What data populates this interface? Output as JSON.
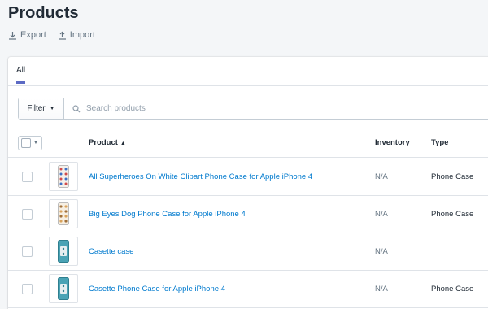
{
  "page": {
    "title": "Products"
  },
  "actions": {
    "export_label": "Export",
    "import_label": "Import"
  },
  "tabs": [
    {
      "label": "All"
    }
  ],
  "filter": {
    "button_label": "Filter",
    "search_placeholder": "Search products"
  },
  "table": {
    "headers": {
      "product": "Product",
      "inventory": "Inventory",
      "type": "Type"
    },
    "rows": [
      {
        "name": "All Superheroes On White Clipart Phone Case for Apple iPhone 4",
        "inventory": "N/A",
        "type": "Phone Case",
        "thumb_icon": "phone-case-pattern-icon"
      },
      {
        "name": "Big Eyes Dog Phone Case for Apple iPhone 4",
        "inventory": "N/A",
        "type": "Phone Case",
        "thumb_icon": "phone-case-pattern-icon"
      },
      {
        "name": "Casette case",
        "inventory": "N/A",
        "type": "",
        "thumb_icon": "phone-case-cassette-icon"
      },
      {
        "name": "Casette Phone Case for Apple iPhone 4",
        "inventory": "N/A",
        "type": "Phone Case",
        "thumb_icon": "phone-case-cassette-icon"
      }
    ]
  },
  "colors": {
    "accent": "#5c6ac4",
    "link": "#007ace",
    "background": "#f4f6f8"
  }
}
